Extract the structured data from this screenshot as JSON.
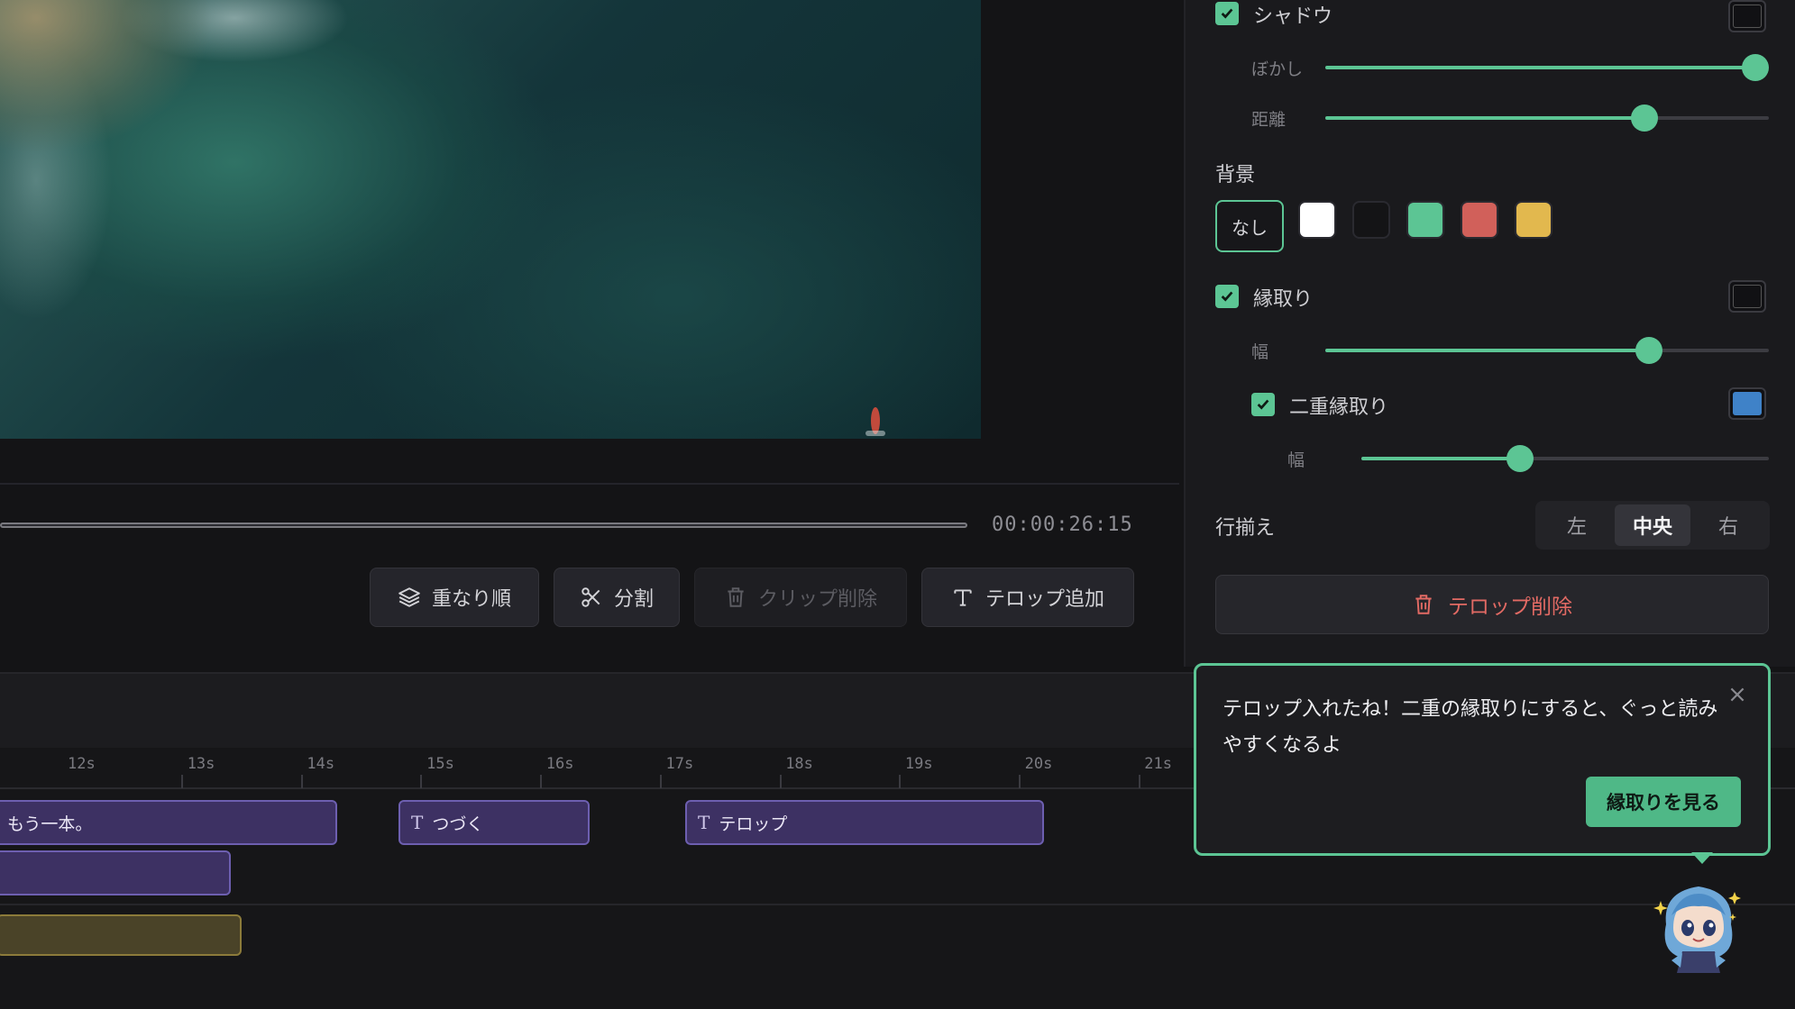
{
  "preview": {
    "timecode": "00:00:26:15"
  },
  "toolbar": {
    "layer_order": "重なり順",
    "split": "分割",
    "delete_clip": "クリップ削除",
    "add_telop": "テロップ追加"
  },
  "panel": {
    "shadow_label": "シャドウ",
    "shadow_blur_label": "ぼかし",
    "shadow_blur_value": 0.97,
    "shadow_distance_label": "距離",
    "shadow_distance_value": 0.72,
    "shadow_color": "#111114",
    "background_label": "背景",
    "background_none": "なし",
    "background_colors": [
      "#ffffff",
      "#141416",
      "#5cc594",
      "#d1605a",
      "#e2b84e"
    ],
    "outline_label": "縁取り",
    "outline_color": "#111114",
    "outline_width_label": "幅",
    "outline_width_value": 0.73,
    "double_outline_label": "二重縁取り",
    "double_outline_color": "#3f82c8",
    "double_outline_width_label": "幅",
    "double_outline_width_value": 0.39,
    "align_label": "行揃え",
    "align_left": "左",
    "align_center": "中央",
    "align_right": "右",
    "delete_telop": "テロップ削除",
    "accent_color": "#5cc594"
  },
  "timeline": {
    "ruler": [
      "12s",
      "13s",
      "14s",
      "15s",
      "16s",
      "17s",
      "18s",
      "19s",
      "20s",
      "21s"
    ],
    "clips": {
      "clip1": "もう一本。",
      "clip2": "つづく",
      "clip3": "テロップ"
    }
  },
  "tooltip": {
    "message": "テロップ入れたね！二重の縁取りにすると、ぐっと読みやすくなるよ",
    "action": "縁取りを見る"
  }
}
